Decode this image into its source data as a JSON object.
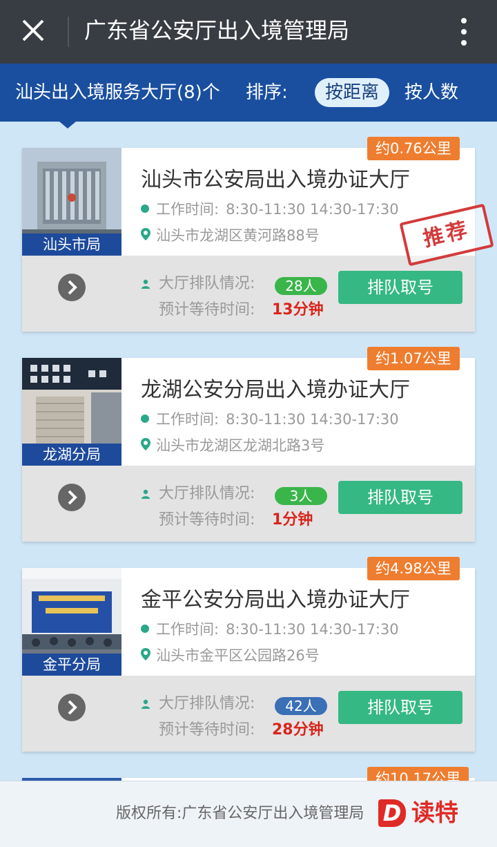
{
  "header": {
    "title": "广东省公安厅出入境管理局"
  },
  "filter": {
    "hall_count_label": "汕头出入境服务大厅(8)个",
    "sort_label": "排序:",
    "sort_by_distance": "按距离",
    "sort_by_people": "按人数"
  },
  "cards": [
    {
      "distance": "约0.76公里",
      "photo_label": "汕头市局",
      "name": "汕头市公安局出入境办证大厅",
      "hours_label": "工作时间:",
      "hours": "8:30-11:30 14:30-17:30",
      "address": "汕头市龙湖区黄河路88号",
      "recommended": "推荐",
      "queue_label": "大厅排队情况:",
      "queue_count": "28人",
      "queue_color": "#3ab54a",
      "wait_label": "预计等待时间:",
      "wait_time": "13分钟",
      "button": "排队取号"
    },
    {
      "distance": "约1.07公里",
      "photo_label": "龙湖分局",
      "name": "龙湖公安分局出入境办证大厅",
      "hours_label": "工作时间:",
      "hours": "8:30-11:30 14:30-17:30",
      "address": "汕头市龙湖区龙湖北路3号",
      "queue_label": "大厅排队情况:",
      "queue_count": "3人",
      "queue_color": "#3ab54a",
      "wait_label": "预计等待时间:",
      "wait_time": "1分钟",
      "button": "排队取号"
    },
    {
      "distance": "约4.98公里",
      "photo_label": "金平分局",
      "name": "金平公安分局出入境办证大厅",
      "hours_label": "工作时间:",
      "hours": "8:30-11:30 14:30-17:30",
      "address": "汕头市金平区公园路26号",
      "queue_label": "大厅排队情况:",
      "queue_count": "42人",
      "queue_color": "#3b6fb6",
      "wait_label": "预计等待时间:",
      "wait_time": "28分钟",
      "button": "排队取号"
    }
  ],
  "partial_card": {
    "distance": "约10.17公里"
  },
  "footer": {
    "copyright": "版权所有:广东省公安厅出入境管理局",
    "logo_letter": "D",
    "logo_text": "读特"
  },
  "colors": {
    "header_bg": "#383c43",
    "filter_bg": "#1a4fa0",
    "accent_orange": "#ef7d2f",
    "button_green": "#35b883",
    "wait_red": "#d9241b"
  },
  "icons": [
    "close-icon",
    "more-icon",
    "clock-icon",
    "location-pin-icon",
    "person-icon",
    "chevron-right-icon"
  ]
}
